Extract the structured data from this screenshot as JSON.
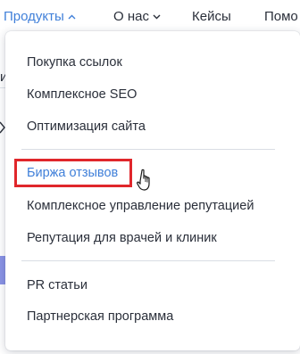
{
  "nav": {
    "products": "Продукты",
    "about": "О нас",
    "cases": "Кейсы",
    "more": "Помо"
  },
  "background": {
    "left_peek": "и",
    "right_peek": "р"
  },
  "menu": {
    "items": [
      "Покупка ссылок",
      "Комплексное SEO",
      "Оптимизация сайта",
      "Биржа отзывов",
      "Комплексное управление репутацией",
      "Репутация для врачей и клиник",
      "PR статьи",
      "Партнерская программа"
    ]
  },
  "colors": {
    "accent": "#3f7fd9",
    "highlight": "#e0262b",
    "band": "#8a93e6"
  },
  "icons": {
    "products_chevron": "chevron-up-icon",
    "about_chevron": "chevron-down-icon",
    "pointer": "hand-pointer-icon"
  }
}
